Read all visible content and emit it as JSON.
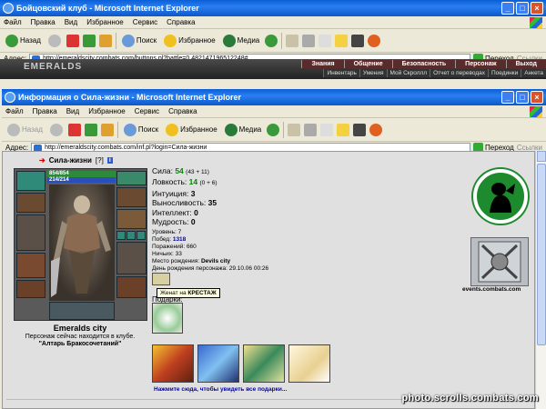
{
  "window1": {
    "title": "Бойцовский клуб - Microsoft Internet Explorer",
    "menu": [
      "Файл",
      "Правка",
      "Вид",
      "Избранное",
      "Сервис",
      "Справка"
    ],
    "toolbar": {
      "back": "Назад",
      "search": "Поиск",
      "favorites": "Избранное",
      "media": "Медиа"
    },
    "address_label": "Адрес:",
    "address": "http://emeraldscity.combats.com/buttons.pl?battle=0.482147196512248#",
    "go": "Переход",
    "links": "Ссылки"
  },
  "game_header": {
    "logo": "EMERALDS",
    "nav1": [
      "Знания",
      "Общение",
      "Безопасность",
      "Персонаж",
      "Выход"
    ],
    "nav2": [
      "Инвентарь",
      "Умения",
      "Мой Скроллл",
      "Отчет о переводах",
      "Поединки",
      "Анкета"
    ]
  },
  "window2": {
    "title": "Информация о Сила-жизни - Microsoft Internet Explorer",
    "menu": [
      "Файл",
      "Правка",
      "Вид",
      "Избранное",
      "Сервис",
      "Справка"
    ],
    "toolbar": {
      "back": "Назад",
      "search": "Поиск",
      "favorites": "Избранное",
      "media": "Медиа"
    },
    "address_label": "Адрес:",
    "address": "http://emeraldscity.combats.com/inf.pl?login=Сила-жизни",
    "go": "Переход",
    "links": "Ссылки"
  },
  "character": {
    "name": "Сила-жизни",
    "help": "[?]",
    "info_icon": "i",
    "hp": "854/854",
    "mp": "214/214",
    "city": "Emeralds city",
    "location_line": "Персонаж сейчас находится в клубе.",
    "location": "\"Алтарь Бракосочетаний\""
  },
  "stats": [
    {
      "label": "Сила:",
      "value": "54",
      "extra": "(43 + 11)",
      "green": true
    },
    {
      "label": "Ловкость:",
      "value": "14",
      "extra": "(0 + 6)",
      "green": true
    },
    {
      "label": "Интуиция:",
      "value": "3",
      "extra": "",
      "green": false
    },
    {
      "label": "Выносливость:",
      "value": "35",
      "extra": "",
      "green": false
    },
    {
      "label": "Интеллект:",
      "value": "0",
      "extra": "",
      "green": false
    },
    {
      "label": "Мудрость:",
      "value": "0",
      "extra": "",
      "green": false
    }
  ],
  "details": {
    "level": "Уровень: 7",
    "wins_label": "Побед:",
    "wins": "1318",
    "losses": "Поражений: 660",
    "draws": "Ничьих: 33",
    "birthplace_label": "Место рождения:",
    "birthplace": "Devils city",
    "birthday": "День рождения персонажа: 29.10.06 00:26"
  },
  "tooltip": {
    "prefix": "Женат на",
    "name": "КРЕСТАЖ"
  },
  "gifts_label": "Подарки:",
  "gifts_link": "Нажмите сюда, чтобы увидеть все подарки...",
  "events_link": "events.combats.com",
  "watermark": "photo.scrolls.combats.com",
  "colors": {
    "xp_blue": "#0a5fd6",
    "hp": "#2c8a3a",
    "mp": "#2a4fb8",
    "emblem": "#1e8a2e"
  }
}
